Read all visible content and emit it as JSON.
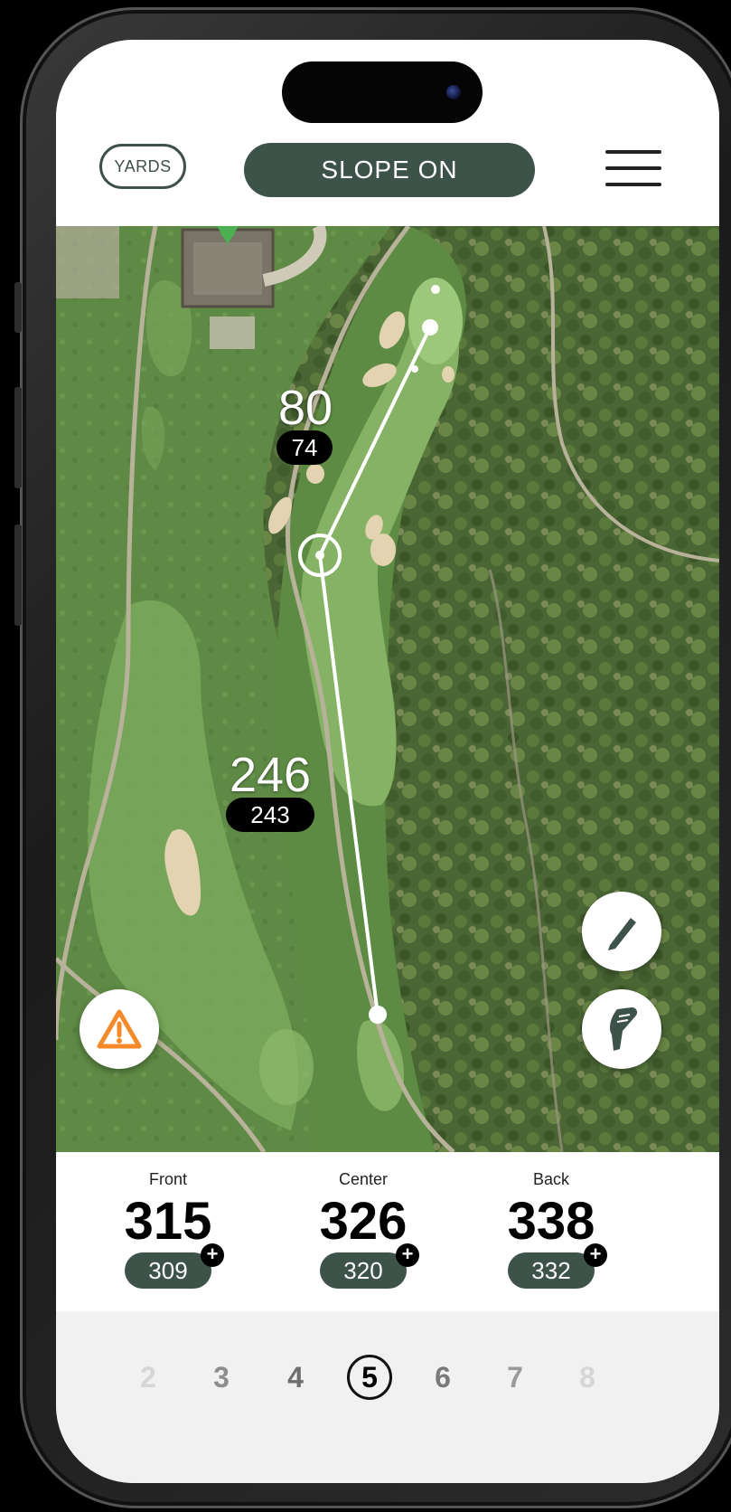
{
  "header": {
    "units_label": "YARDS",
    "slope_label": "SLOPE ON",
    "menu_icon": "hamburger-menu-icon"
  },
  "map": {
    "markers": [
      {
        "distance": "80",
        "slope_distance": "74"
      },
      {
        "distance": "246",
        "slope_distance": "243"
      }
    ],
    "tools": {
      "hazard_icon": "warning-triangle-icon",
      "edit_icon": "pencil-icon",
      "club_icon": "golf-club-icon"
    },
    "colors": {
      "fairway": "#7aa25a",
      "green": "#8fbb6e",
      "trees": "#4c6a34",
      "sand": "#e3d3b0",
      "accent": "#3d5249",
      "hazard": "#f58a2a"
    }
  },
  "distances": {
    "front": {
      "label": "Front",
      "value": "315",
      "slope": "309"
    },
    "center": {
      "label": "Center",
      "value": "326",
      "slope": "320"
    },
    "back": {
      "label": "Back",
      "value": "338",
      "slope": "332"
    },
    "plus_symbol": "+"
  },
  "holes": {
    "items": [
      "2",
      "3",
      "4",
      "5",
      "6",
      "7",
      "8"
    ],
    "current": "5"
  }
}
